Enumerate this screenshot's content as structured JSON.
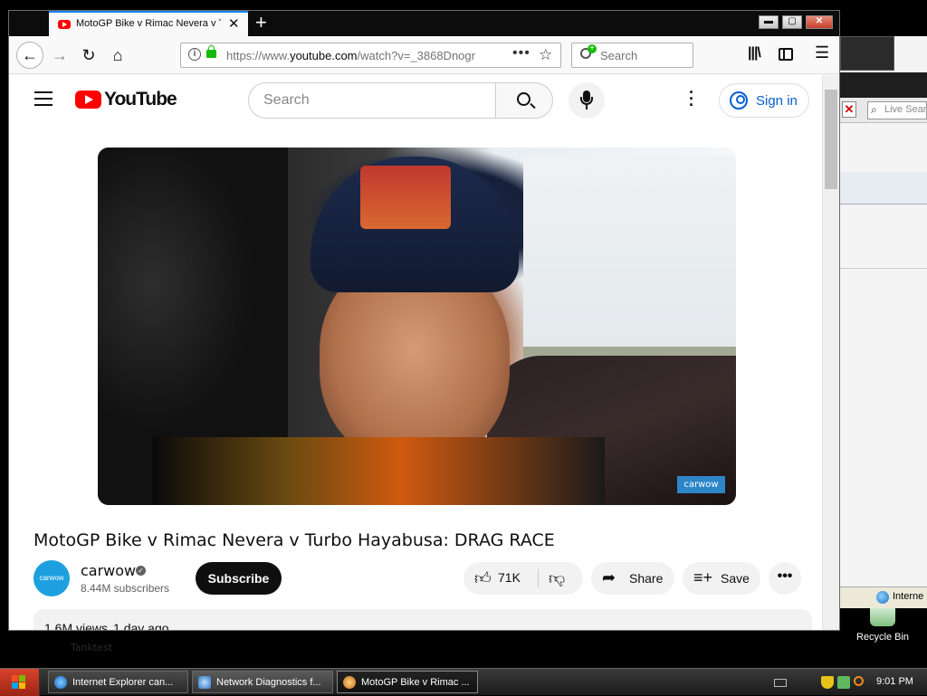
{
  "desktop": {
    "faint_text": "Tanktest",
    "recycle_bin_label": "Recycle Bin"
  },
  "background_window": {
    "search_placeholder": "Live Search",
    "status_text": "Interne"
  },
  "browser": {
    "tab_title": "MotoGP Bike v Rimac Nevera v Tur",
    "new_tab_symbol": "+",
    "url_prefix": "https://www.",
    "url_main": "youtube.com",
    "url_suffix": "/watch?v=_3868Dnogr",
    "search_placeholder": "Search",
    "controls": {
      "minimize": "▬",
      "maximize": "▢",
      "close": "✕"
    }
  },
  "youtube": {
    "logo_text": "YouTube",
    "search_placeholder": "Search",
    "sign_in_label": "Sign in",
    "video": {
      "watermark": "carwow",
      "title": "MotoGP Bike v Rimac Nevera v Turbo Hayabusa: DRAG RACE"
    },
    "channel": {
      "avatar_text": "carwow",
      "name": "carwow",
      "subscribers": "8.44M subscribers",
      "subscribe_label": "Subscribe"
    },
    "actions": {
      "like_count": "71K",
      "share_label": "Share",
      "save_label": "Save",
      "more_symbol": "•••"
    },
    "description": {
      "views": "1.6M views",
      "date": "1 day ago"
    }
  },
  "taskbar": {
    "tasks": [
      {
        "label": "Internet Explorer can..."
      },
      {
        "label": "Network Diagnostics f..."
      },
      {
        "label": "MotoGP Bike v Rimac ..."
      }
    ],
    "clock": "9:01 PM"
  },
  "colors": {
    "youtube_red": "#ff0000",
    "link_blue": "#065fd4",
    "firefox_accent": "#0a84ff",
    "carwow_blue": "#2d86c8"
  }
}
